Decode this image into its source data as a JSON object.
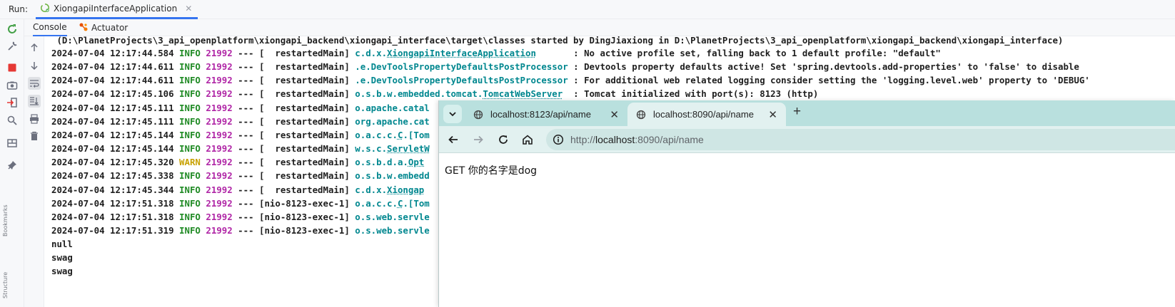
{
  "run_bar": {
    "label": "Run:",
    "tab_title": "XiongapiInterfaceApplication",
    "close_glyph": "✕"
  },
  "sub_tabs": {
    "console": "Console",
    "actuator": "Actuator"
  },
  "left_strip": {
    "vertical_labels": [
      "Bookmarks",
      "Structure"
    ]
  },
  "console": {
    "header_line": " (D:\\PlanetProjects\\3_api_openplatform\\xiongapi_backend\\xiongapi_interface\\target\\classes started by DingJiaxiong in D:\\PlanetProjects\\3_api_openplatform\\xiongapi_backend\\xiongapi_interface)",
    "log_lines": [
      {
        "ts": "2024-07-04 12:17:44.584",
        "level": "INFO",
        "pid": "21992",
        "sep": " --- ",
        "thread": "[  restartedMain]",
        "pre": "c.d.x.",
        "link": "XiongapiInterfaceApplication",
        "post": "      ",
        "msg": " : No active profile set, falling back to 1 default profile: \"default\""
      },
      {
        "ts": "2024-07-04 12:17:44.611",
        "level": "INFO",
        "pid": "21992",
        "sep": " --- ",
        "thread": "[  restartedMain]",
        "pre": ".e.DevToolsPropertyDefaultsPostProcessor",
        "link": "",
        "post": "",
        "msg": " : Devtools property defaults active! Set 'spring.devtools.add-properties' to 'false' to disable"
      },
      {
        "ts": "2024-07-04 12:17:44.611",
        "level": "INFO",
        "pid": "21992",
        "sep": " --- ",
        "thread": "[  restartedMain]",
        "pre": ".e.DevToolsPropertyDefaultsPostProcessor",
        "link": "",
        "post": "",
        "msg": " : For additional web related logging consider setting the 'logging.level.web' property to 'DEBUG'"
      },
      {
        "ts": "2024-07-04 12:17:45.106",
        "level": "INFO",
        "pid": "21992",
        "sep": " --- ",
        "thread": "[  restartedMain]",
        "pre": "o.s.b.w.embedded.tomcat.",
        "link": "TomcatWebServer",
        "post": " ",
        "msg": " : Tomcat initialized with port(s): 8123 (http)"
      },
      {
        "ts": "2024-07-04 12:17:45.111",
        "level": "INFO",
        "pid": "21992",
        "sep": " --- ",
        "thread": "[  restartedMain]",
        "pre": "o.apache.catal",
        "link": "",
        "post": "",
        "msg": ""
      },
      {
        "ts": "2024-07-04 12:17:45.111",
        "level": "INFO",
        "pid": "21992",
        "sep": " --- ",
        "thread": "[  restartedMain]",
        "pre": "org.apache.cat",
        "link": "",
        "post": "",
        "msg": ""
      },
      {
        "ts": "2024-07-04 12:17:45.144",
        "level": "INFO",
        "pid": "21992",
        "sep": " --- ",
        "thread": "[  restartedMain]",
        "pre": "o.a.c.c.",
        "link": "C",
        "post": ".[Tom",
        "msg": ""
      },
      {
        "ts": "2024-07-04 12:17:45.144",
        "level": "INFO",
        "pid": "21992",
        "sep": " --- ",
        "thread": "[  restartedMain]",
        "pre": "w.s.c.",
        "link": "ServletW",
        "post": "",
        "msg": ""
      },
      {
        "ts": "2024-07-04 12:17:45.320",
        "level": "WARN",
        "pid": "21992",
        "sep": " --- ",
        "thread": "[  restartedMain]",
        "pre": "o.s.b.d.a.",
        "link": "Opt",
        "post": "",
        "msg": ""
      },
      {
        "ts": "2024-07-04 12:17:45.338",
        "level": "INFO",
        "pid": "21992",
        "sep": " --- ",
        "thread": "[  restartedMain]",
        "pre": "o.s.b.w.embedd",
        "link": "",
        "post": "",
        "msg": ""
      },
      {
        "ts": "2024-07-04 12:17:45.344",
        "level": "INFO",
        "pid": "21992",
        "sep": " --- ",
        "thread": "[  restartedMain]",
        "pre": "c.d.x.",
        "link": "Xiongap",
        "post": "",
        "msg": ""
      },
      {
        "ts": "2024-07-04 12:17:51.318",
        "level": "INFO",
        "pid": "21992",
        "sep": " --- ",
        "thread": "[nio-8123-exec-1]",
        "pre": "o.a.c.c.",
        "link": "C",
        "post": ".[Tom",
        "msg": ""
      },
      {
        "ts": "2024-07-04 12:17:51.318",
        "level": "INFO",
        "pid": "21992",
        "sep": " --- ",
        "thread": "[nio-8123-exec-1]",
        "pre": "o.s.web.servle",
        "link": "",
        "post": "",
        "msg": ""
      },
      {
        "ts": "2024-07-04 12:17:51.319",
        "level": "INFO",
        "pid": "21992",
        "sep": " --- ",
        "thread": "[nio-8123-exec-1]",
        "pre": "o.s.web.servle",
        "link": "",
        "post": "",
        "msg": ""
      }
    ],
    "plain_lines": [
      "null",
      "swag",
      "swag"
    ]
  },
  "browser": {
    "tabs": [
      {
        "title": "localhost:8123/api/name",
        "active": false
      },
      {
        "title": "localhost:8090/api/name",
        "active": true
      }
    ],
    "new_tab_glyph": "+",
    "address": {
      "scheme": "http://",
      "host": "localhost",
      "path": ":8090/api/name"
    },
    "page_text": "GET 你的名字是dog"
  },
  "colors": {
    "accent": "#3574f0",
    "info": "#1f8a24",
    "warn": "#c7a100",
    "pid": "#b026a6",
    "logger": "#00878f",
    "browser_frame": "#b9e0de"
  }
}
